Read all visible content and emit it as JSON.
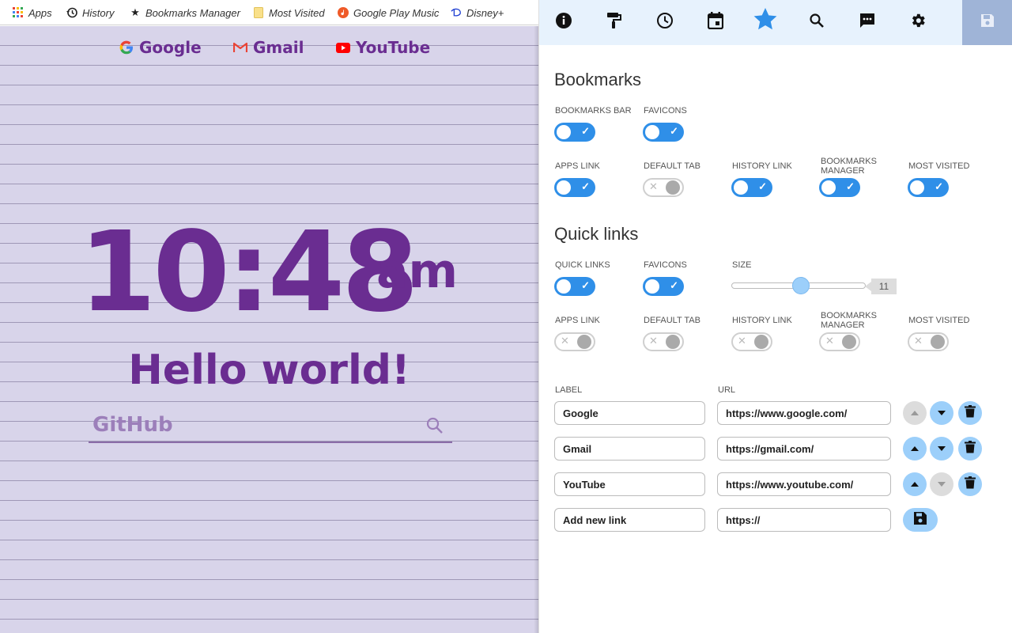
{
  "bookmarks_bar": {
    "items": [
      {
        "label": "Apps",
        "icon": "apps-grid-icon"
      },
      {
        "label": "History",
        "icon": "history-icon"
      },
      {
        "label": "Bookmarks Manager",
        "icon": "star-icon"
      },
      {
        "label": "Most Visited",
        "icon": "folder-icon"
      },
      {
        "label": "Google Play Music",
        "icon": "play-music-icon"
      },
      {
        "label": "Disney+",
        "icon": "disney-icon"
      }
    ]
  },
  "preview": {
    "quick_links": [
      {
        "label": "Google",
        "icon": "google-icon"
      },
      {
        "label": "Gmail",
        "icon": "gmail-icon"
      },
      {
        "label": "YouTube",
        "icon": "youtube-icon"
      }
    ],
    "clock_time": "10:48",
    "clock_ampm": "am",
    "greeting": "Hello world!",
    "search_text": "GitHub",
    "accent_color": "#6a2d91"
  },
  "toolbar": {
    "icons": [
      "info-icon",
      "paint-roller-icon",
      "clock-icon",
      "calendar-icon",
      "star-icon",
      "search-icon",
      "message-icon",
      "gear-icon"
    ],
    "active": "star-icon",
    "active_color": "#2f8fe8",
    "save_icon": "save-icon"
  },
  "bookmarks_section": {
    "title": "Bookmarks",
    "row1": [
      {
        "label": "BOOKMARKS BAR",
        "on": true
      },
      {
        "label": "FAVICONS",
        "on": true
      }
    ],
    "row2": [
      {
        "label": "APPS LINK",
        "on": true
      },
      {
        "label": "DEFAULT TAB",
        "on": false
      },
      {
        "label": "HISTORY LINK",
        "on": true
      },
      {
        "label": "BOOKMARKS MANAGER",
        "on": true
      },
      {
        "label": "MOST VISITED",
        "on": true
      }
    ]
  },
  "quick_links_section": {
    "title": "Quick links",
    "row1": [
      {
        "label": "QUICK LINKS",
        "on": true
      },
      {
        "label": "FAVICONS",
        "on": true
      }
    ],
    "size_label": "SIZE",
    "size_value": "11",
    "size_fraction": 0.52,
    "row2": [
      {
        "label": "APPS LINK",
        "on": false
      },
      {
        "label": "DEFAULT TAB",
        "on": false
      },
      {
        "label": "HISTORY LINK",
        "on": false
      },
      {
        "label": "BOOKMARKS MANAGER",
        "on": false
      },
      {
        "label": "MOST VISITED",
        "on": false
      }
    ],
    "col_label": "LABEL",
    "col_url": "URL",
    "links": [
      {
        "label": "Google",
        "url": "https://www.google.com/",
        "up_enabled": false,
        "down_enabled": true
      },
      {
        "label": "Gmail",
        "url": "https://gmail.com/",
        "up_enabled": true,
        "down_enabled": true
      },
      {
        "label": "YouTube",
        "url": "https://www.youtube.com/",
        "up_enabled": true,
        "down_enabled": false
      }
    ],
    "new_link": {
      "label": "Add new link",
      "url": "https://"
    }
  }
}
